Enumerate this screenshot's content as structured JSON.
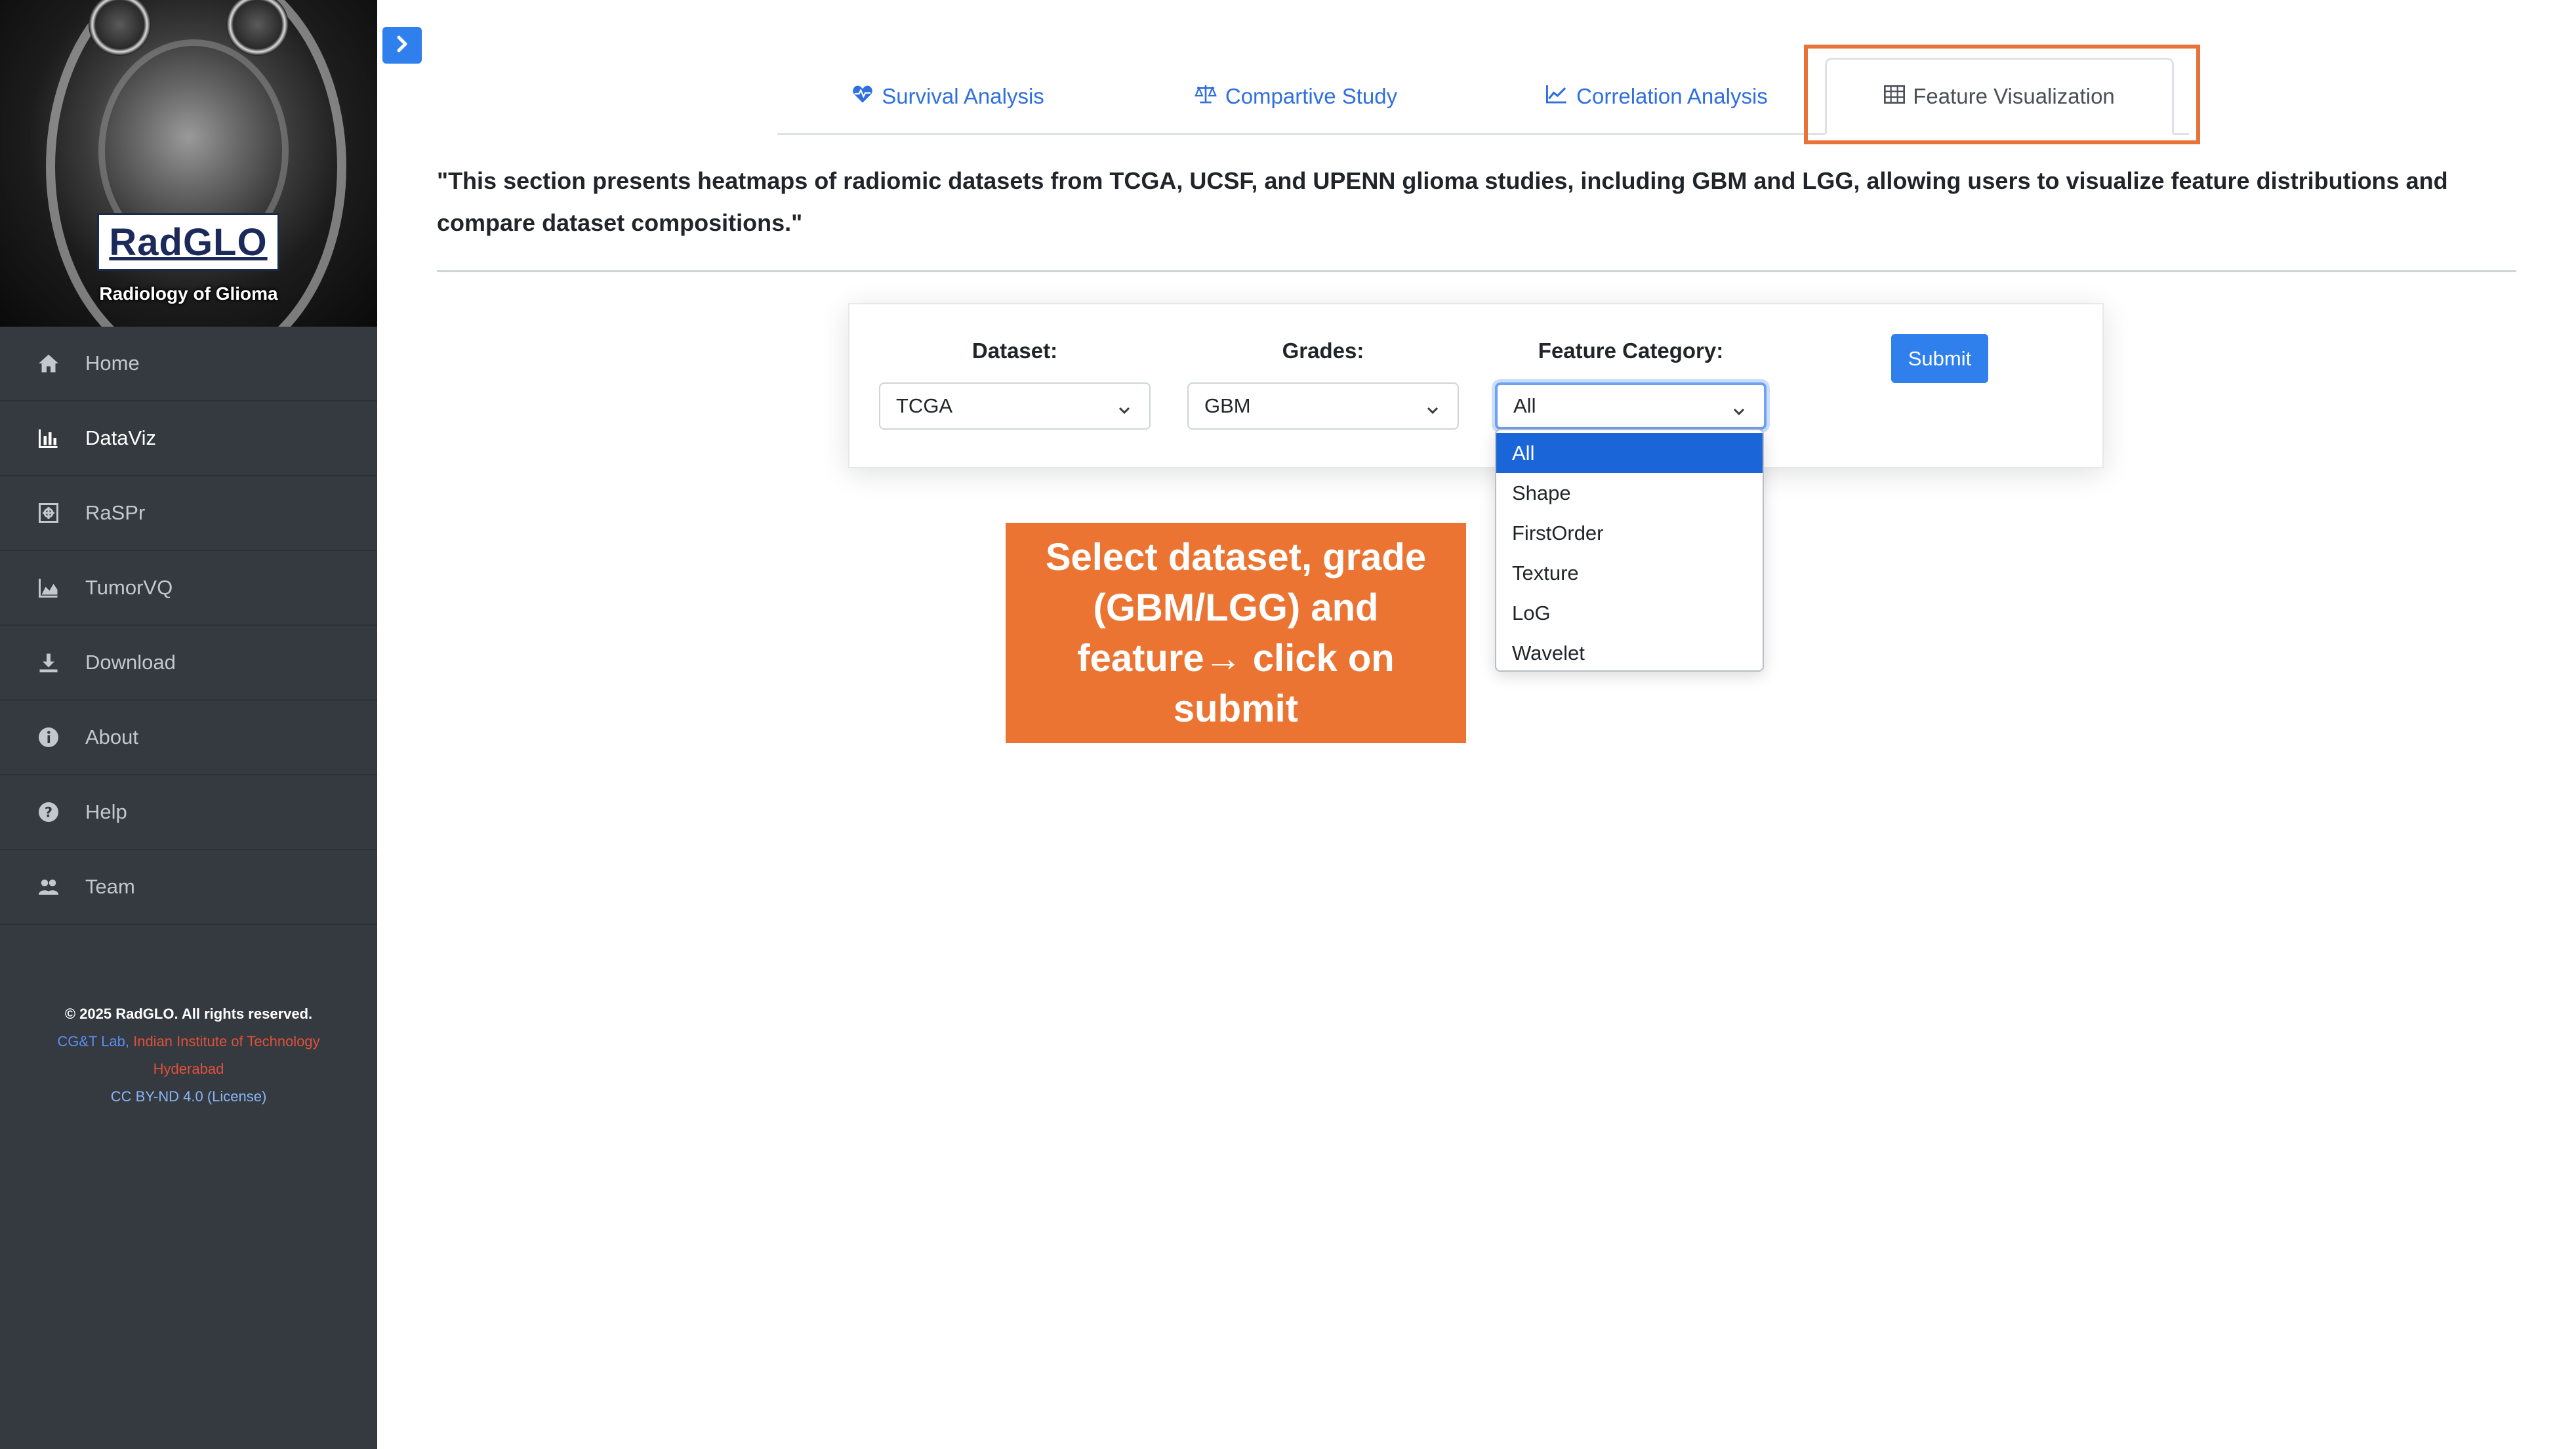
{
  "brand": {
    "name": "RadGLO",
    "subtitle": "Radiology of Glioma"
  },
  "sidebar": {
    "items": [
      {
        "label": "Home",
        "icon": "home-icon"
      },
      {
        "label": "DataViz",
        "icon": "bar-chart-icon",
        "active": true
      },
      {
        "label": "RaSPr",
        "icon": "scan-icon"
      },
      {
        "label": "TumorVQ",
        "icon": "area-chart-icon"
      },
      {
        "label": "Download",
        "icon": "download-icon"
      },
      {
        "label": "About",
        "icon": "info-icon"
      },
      {
        "label": "Help",
        "icon": "help-icon"
      },
      {
        "label": "Team",
        "icon": "users-icon"
      }
    ],
    "footer": {
      "copyright": "© 2025 RadGLO. All rights reserved.",
      "lab": "CG&T Lab,",
      "institute_line1": "Indian Institute of Technology",
      "institute_line2": "Hyderabad",
      "license": "CC BY-ND 4.0 (License)"
    }
  },
  "tabs": [
    {
      "label": "Survival Analysis",
      "icon": "heartbeat-icon"
    },
    {
      "label": "Compartive Study",
      "icon": "balance-scale-icon"
    },
    {
      "label": "Correlation Analysis",
      "icon": "line-chart-icon"
    },
    {
      "label": "Feature Visualization",
      "icon": "table-icon",
      "active": true
    }
  ],
  "description": "\"This section presents heatmaps of radiomic datasets from TCGA, UCSF, and UPENN glioma studies, including GBM and LGG, allowing users to visualize feature distributions and compare dataset compositions.\"",
  "form": {
    "dataset_label": "Dataset:",
    "dataset_value": "TCGA",
    "grades_label": "Grades:",
    "grades_value": "GBM",
    "feature_label": "Feature Category:",
    "feature_value": "All",
    "submit_label": "Submit",
    "feature_options": [
      "All",
      "Shape",
      "FirstOrder",
      "Texture",
      "LoG",
      "Wavelet"
    ]
  },
  "annotation": {
    "line1": "Select dataset, grade",
    "line2": "(GBM/LGG) and",
    "line3": "feature→ click on",
    "line4": "submit"
  },
  "colors": {
    "sidebar_bg": "#343a40",
    "accent": "#2f80ed",
    "annotation": "#ec7432",
    "selected_option": "#1a66d9"
  }
}
